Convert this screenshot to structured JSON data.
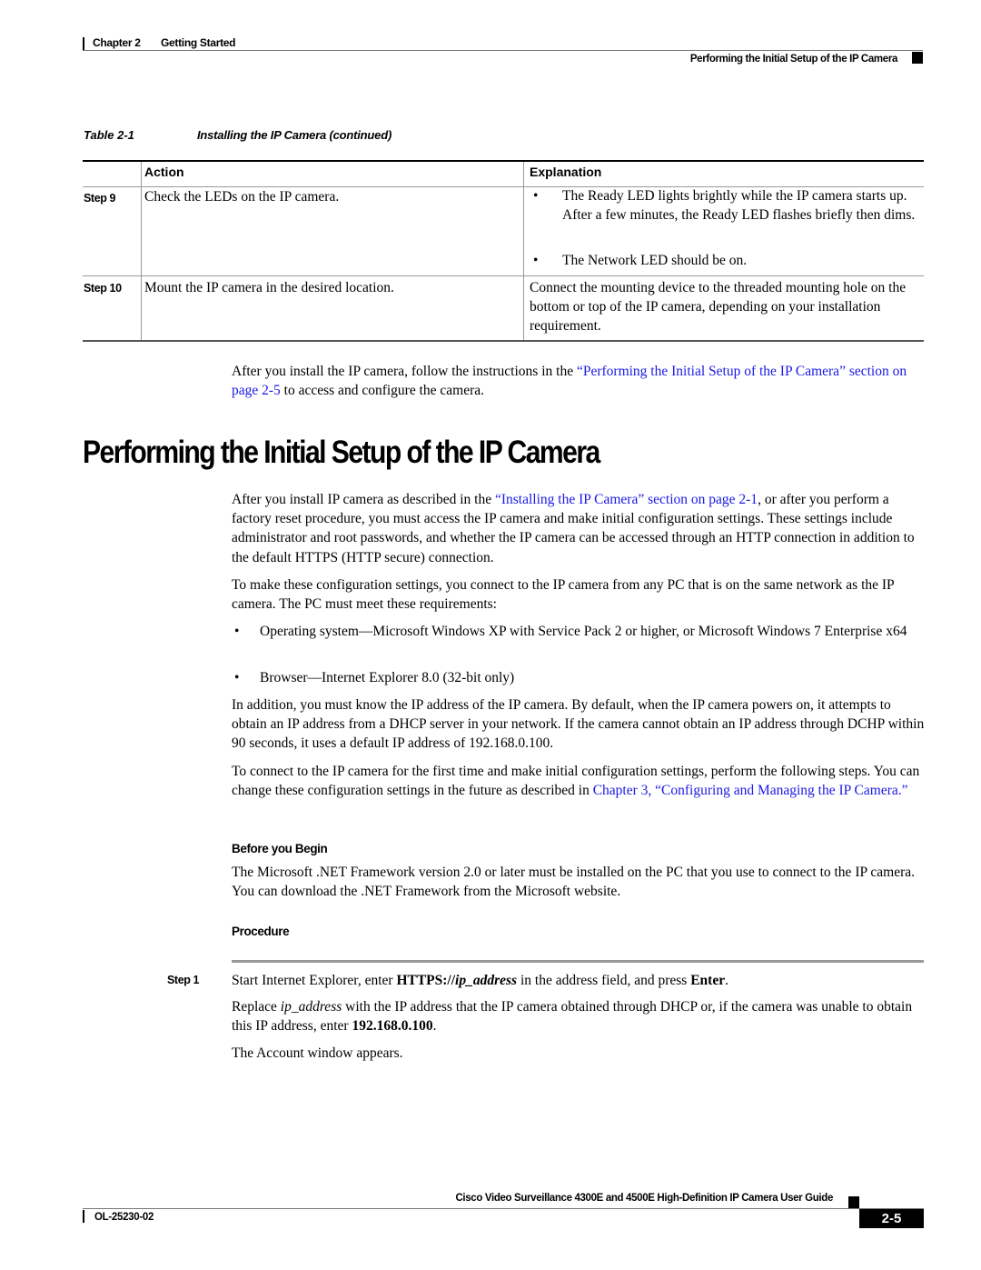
{
  "header": {
    "chapter_label": "Chapter 2",
    "chapter_title": "Getting Started",
    "section_title": "Performing the Initial Setup of the IP Camera"
  },
  "table": {
    "caption_number": "Table 2-1",
    "caption_title": "Installing the IP Camera (continued)",
    "columns": [
      "",
      "Action",
      "Explanation"
    ],
    "rows": [
      {
        "step": "Step 9",
        "action": "Check the LEDs on the IP camera.",
        "explanation_bullets": [
          "The Ready LED lights brightly while the IP camera starts up. After a few minutes, the Ready LED flashes briefly then dims.",
          "The Network LED should be on."
        ]
      },
      {
        "step": "Step 10",
        "action": "Mount the IP camera in the desired location.",
        "explanation": "Connect the mounting device to the threaded mounting hole on the bottom or top of the IP camera, depending on your installation requirement."
      }
    ]
  },
  "after_table": {
    "text_before": "After you install the IP camera, follow the instructions in the ",
    "link": "“Performing the Initial Setup of the IP Camera” section on page 2-5",
    "text_after": " to access and configure the camera."
  },
  "section": {
    "heading": "Performing the Initial Setup of the IP Camera",
    "intro": {
      "text_before": "After you install IP camera as described in the ",
      "link": "“Installing the IP Camera” section on page 2-1",
      "text_after": ", or after you perform a factory reset procedure, you must access the IP camera and make initial configuration settings. These settings include administrator and root passwords, and whether the IP camera can be accessed through an HTTP connection in addition to the default HTTPS (HTTP secure) connection."
    },
    "requirements_intro": "To make these configuration settings, you connect to the IP camera from any PC that is on the same network as the IP camera. The PC must meet these requirements:",
    "requirements": [
      "Operating system—Microsoft Windows XP with Service Pack 2 or higher, or Microsoft Windows 7 Enterprise x64",
      "Browser—Internet Explorer 8.0 (32-bit only)"
    ],
    "ip_paragraph": "In addition, you must know the IP address of the IP camera. By default, when the IP camera powers on, it attempts to obtain an IP address from a DHCP server in your network. If the camera cannot obtain an IP address through DCHP within 90 seconds, it uses a default IP address of 192.168.0.100.",
    "connect_paragraph": {
      "text_before": "To connect to the IP camera for the first time and make initial configuration settings, perform the following steps. You can change these configuration settings in the future as described in ",
      "link": "Chapter 3, “Configuring and Managing the IP Camera.”"
    },
    "before_you_begin_heading": "Before you Begin",
    "before_you_begin_text": "The Microsoft .NET Framework version 2.0 or later must be installed on the PC that you use to connect to the IP camera. You can download the .NET Framework from the Microsoft website.",
    "procedure_heading": "Procedure",
    "procedure_steps": [
      {
        "step": "Step 1",
        "line1_a": "Start Internet Explorer, enter ",
        "line1_b_bold": "HTTPS://",
        "line1_c_bolditalic": "ip_address",
        "line1_d": " in the address field, and press ",
        "line1_e_bold": "Enter",
        "line1_f": ".",
        "line2_a": "Replace ",
        "line2_b_italic": "ip_address",
        "line2_c": " with the IP address that the IP camera obtained through DHCP or, if the camera was unable to obtain this IP address, enter ",
        "line2_d_bold": "192.168.0.100",
        "line2_e": ".",
        "line3": "The Account window appears."
      }
    ]
  },
  "footer": {
    "guide_title": "Cisco Video Surveillance 4300E and 4500E High-Definition IP Camera User Guide",
    "doc_number": "OL-25230-02",
    "page_number": "2-5"
  },
  "colors": {
    "link": "#1a1ae6",
    "text": "#000000",
    "rule": "#999999"
  }
}
